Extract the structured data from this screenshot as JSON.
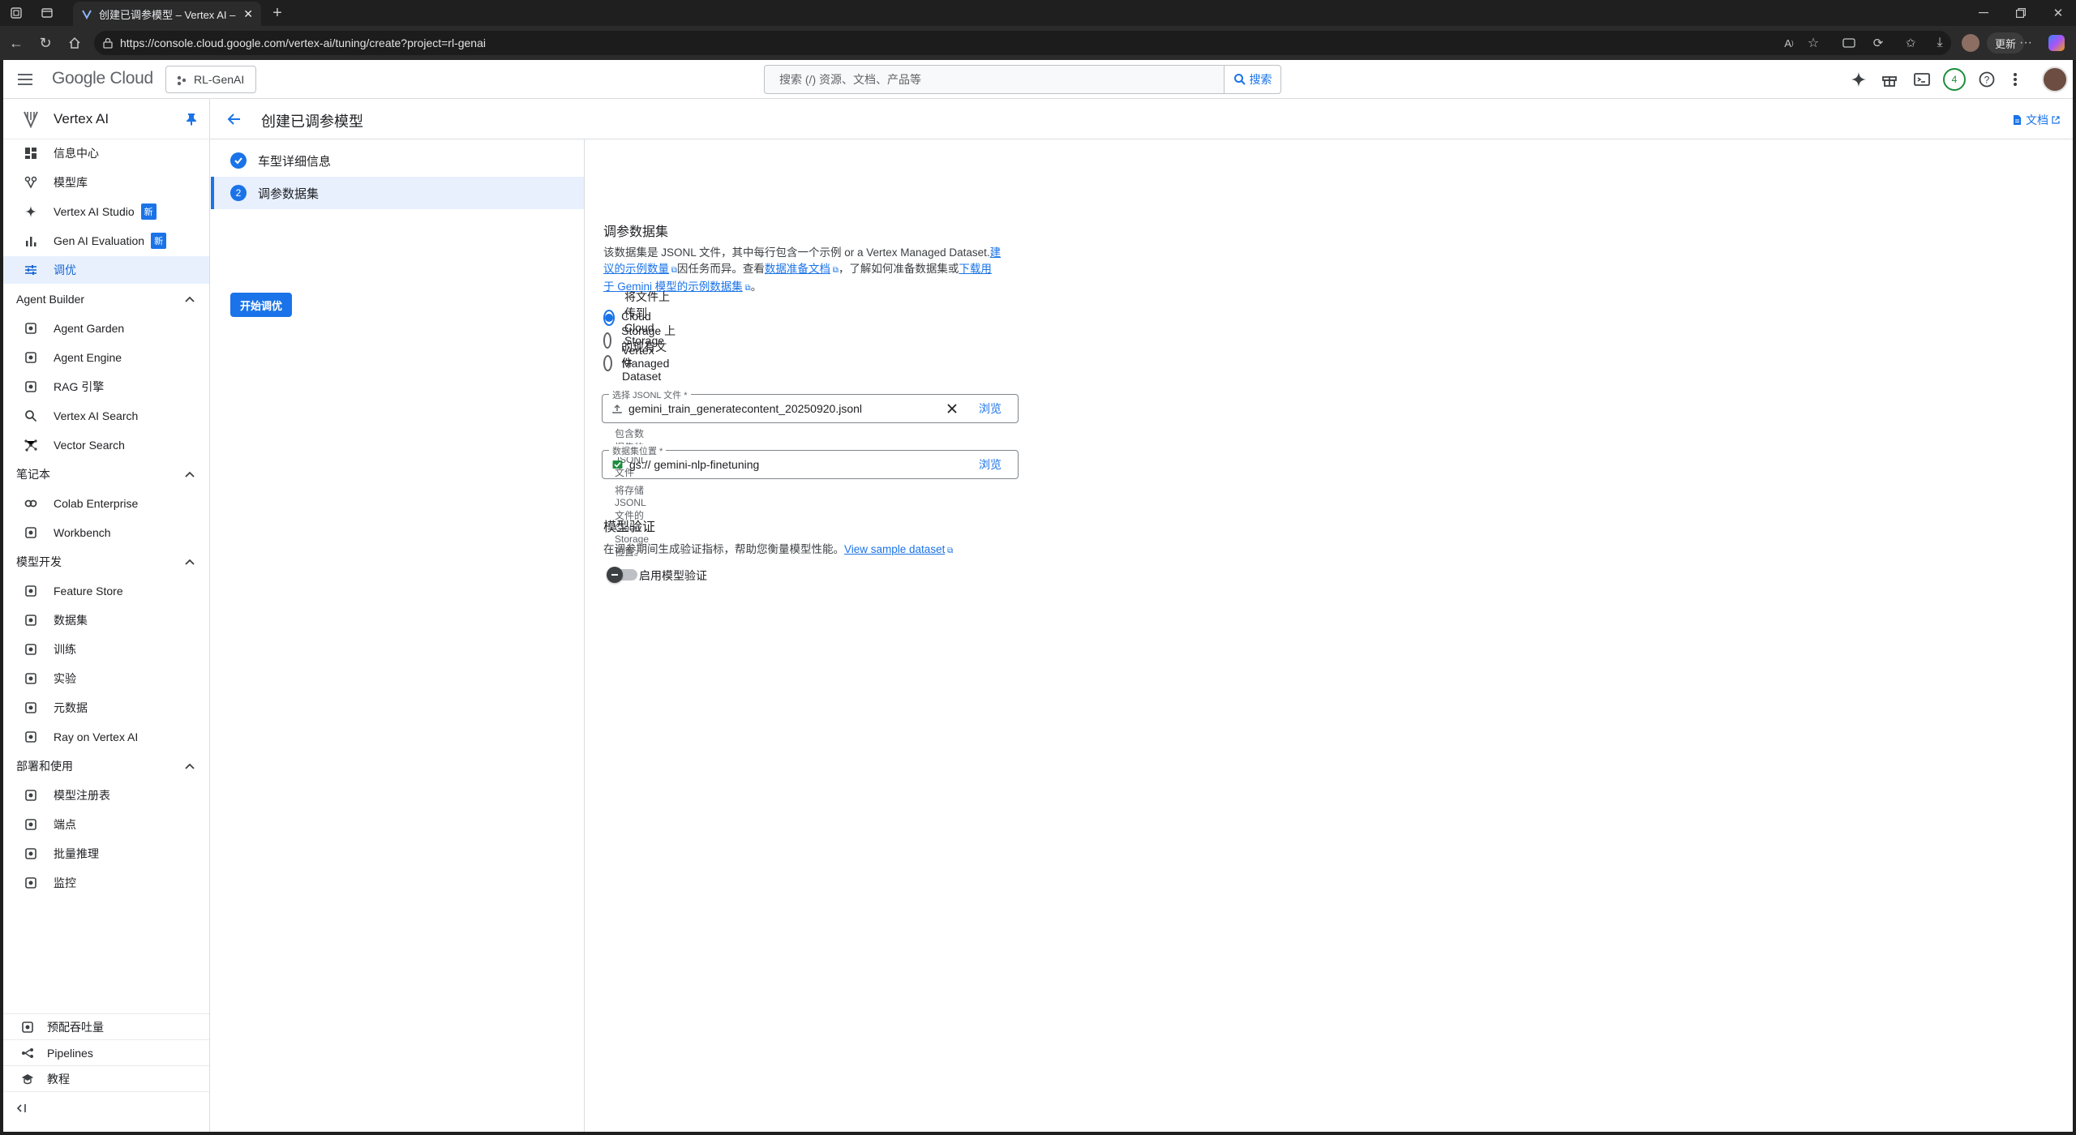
{
  "browser": {
    "tab_title": "创建已调参模型 – Vertex AI – RL-G",
    "url": "https://console.cloud.google.com/vertex-ai/tuning/create?project=rl-genai",
    "update_label": "更新"
  },
  "header": {
    "logo_google": "Google",
    "logo_cloud": "Cloud",
    "project": "RL-GenAI",
    "search_placeholder": "搜索 (/) 资源、文档、产品等",
    "search_button": "搜索",
    "notification_count": "4"
  },
  "subheader": {
    "title": "创建已调参模型",
    "docs": "文档"
  },
  "sidebar": {
    "app_name": "Vertex AI",
    "items_top": [
      {
        "label": "信息中心",
        "icon": "dashboard-icon"
      },
      {
        "label": "模型库",
        "icon": "model-garden-icon"
      },
      {
        "label": "Vertex AI Studio",
        "icon": "sparkle-icon",
        "badge": "新"
      },
      {
        "label": "Gen AI Evaluation",
        "icon": "chart-icon",
        "badge": "新"
      },
      {
        "label": "调优",
        "icon": "tune-icon",
        "active": true
      }
    ],
    "section_agent": "Agent Builder",
    "items_agent": [
      {
        "label": "Agent Garden",
        "icon": "agent-garden-icon"
      },
      {
        "label": "Agent Engine",
        "icon": "agent-engine-icon"
      },
      {
        "label": "RAG 引擎",
        "icon": "rag-icon"
      },
      {
        "label": "Vertex AI Search",
        "icon": "search-icon"
      },
      {
        "label": "Vector Search",
        "icon": "vector-icon"
      }
    ],
    "section_notebook": "笔记本",
    "items_notebook": [
      {
        "label": "Colab Enterprise",
        "icon": "colab-icon"
      },
      {
        "label": "Workbench",
        "icon": "workbench-icon"
      }
    ],
    "section_dev": "模型开发",
    "items_dev": [
      {
        "label": "Feature Store",
        "icon": "feature-store-icon"
      },
      {
        "label": "数据集",
        "icon": "dataset-icon"
      },
      {
        "label": "训练",
        "icon": "training-icon"
      },
      {
        "label": "实验",
        "icon": "experiment-icon"
      },
      {
        "label": "元数据",
        "icon": "metadata-icon"
      },
      {
        "label": "Ray on Vertex AI",
        "icon": "ray-icon"
      }
    ],
    "section_deploy": "部署和使用",
    "items_deploy": [
      {
        "label": "模型注册表",
        "icon": "registry-icon"
      },
      {
        "label": "端点",
        "icon": "endpoint-icon"
      },
      {
        "label": "批量推理",
        "icon": "batch-icon"
      },
      {
        "label": "监控",
        "icon": "monitor-icon"
      }
    ],
    "bottom": [
      {
        "label": "预配吞吐量",
        "icon": "throughput-icon"
      },
      {
        "label": "Pipelines",
        "icon": "pipelines-icon"
      },
      {
        "label": "教程",
        "icon": "school-icon"
      }
    ]
  },
  "steps": [
    {
      "label": "车型详细信息",
      "state": "done"
    },
    {
      "label": "调参数据集",
      "state": "active",
      "num": "2"
    }
  ],
  "start_button": "开始调优",
  "form": {
    "title": "调参数据集",
    "desc_1": "该数据集是 JSONL 文件，其中每行包含一个示例 or a Vertex Managed Dataset.",
    "desc_link1a": "建",
    "desc_link1b": "议的示例数量",
    "desc_2": "因任务而异。查看",
    "desc_link2": "数据准备文档",
    "desc_3": "，了解如何准备数据集或",
    "desc_link3a": "下载用",
    "desc_link3b": "于 Gemini 模型的示例数据集",
    "desc_4": "。",
    "radios": [
      {
        "label": "将文件上传到 Cloud Storage",
        "checked": true
      },
      {
        "label": "Cloud Storage 上的现有文件",
        "checked": false
      },
      {
        "label": "Vertex Managed Dataset",
        "checked": false
      }
    ],
    "file_label": "选择 JSONL 文件 *",
    "file_value": "gemini_train_generatecontent_20250920.jsonl",
    "file_browse": "浏览",
    "file_hint": "包含数据集的 JSONL 文件",
    "loc_label": "数据集位置 *",
    "loc_value": "gs:// gemini-nlp-finetuning",
    "loc_browse": "浏览",
    "loc_hint": "将存储 JSONL 文件的 Cloud Storage 位置。",
    "val_title": "模型验证",
    "val_desc": "在调参期间生成验证指标，帮助您衡量模型性能。",
    "val_link": "View sample dataset",
    "val_toggle": "启用模型验证"
  }
}
